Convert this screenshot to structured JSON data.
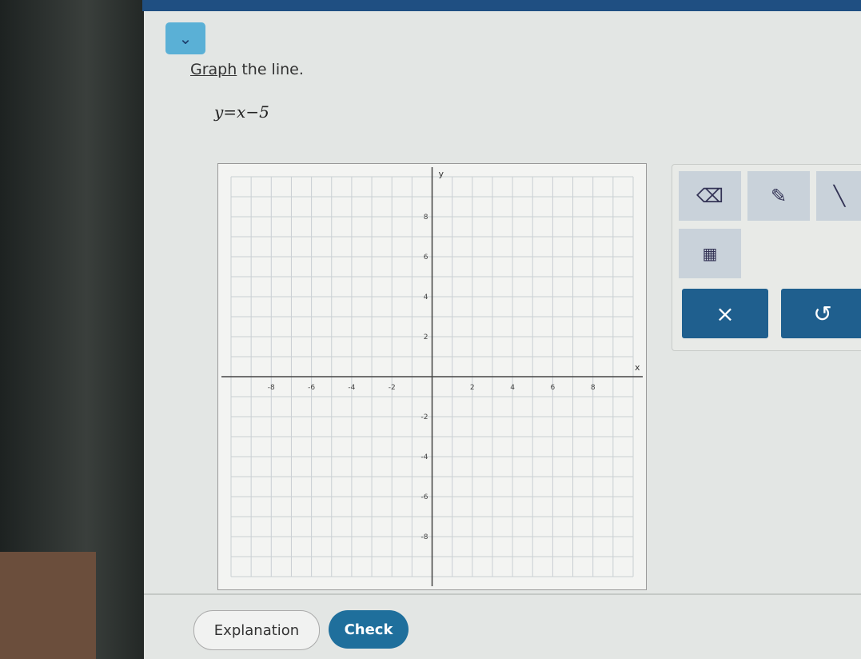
{
  "question": {
    "instruction_underlined": "Graph",
    "instruction_rest": " the line.",
    "equation": "y=x−5"
  },
  "graph": {
    "x_label": "x",
    "y_label": "y",
    "x_range": [
      -10,
      10
    ],
    "y_range": [
      -10,
      10
    ],
    "x_ticks": [
      "-8",
      "-6",
      "-4",
      "-2",
      "2",
      "4",
      "6",
      "8"
    ],
    "y_ticks": [
      "8",
      "6",
      "4",
      "2",
      "-2",
      "-4",
      "-6",
      "-8"
    ],
    "grid": true
  },
  "tools": {
    "eraser": "eraser-icon",
    "pencil": "pencil-icon",
    "line": "line-tool-icon",
    "table": "table-icon",
    "clear": "×",
    "undo": "↺"
  },
  "buttons": {
    "explanation": "Explanation",
    "check": "Check"
  },
  "colors": {
    "accent": "#1f5f8e",
    "header": "#1f4f82"
  }
}
